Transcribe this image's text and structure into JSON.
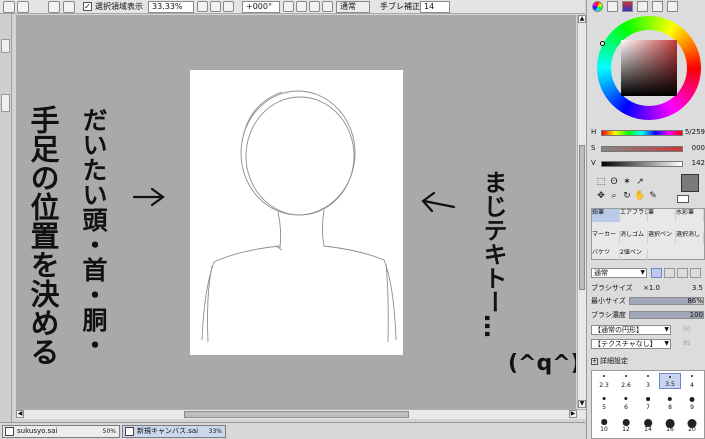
{
  "toolbar": {
    "selection_toggle_label": "選択領域表示",
    "zoom_value": "33.33%",
    "rotation_value": "+000°",
    "blend_mode": "通常",
    "stabilizer_label": "手ブレ補正",
    "stabilizer_value": "14"
  },
  "canvas_annotations": {
    "left_vertical_1": "手足の位置を決める",
    "left_vertical_2": "だいたい頭・首・胴・",
    "right_vertical": "まじテキトー…",
    "right_face": "(^q^)"
  },
  "document_tabs": [
    {
      "name": "sukusyo.sai",
      "zoom": "50%",
      "active": false
    },
    {
      "name": "新規キャンバス.sai",
      "zoom": "33%",
      "active": true
    }
  ],
  "color_panel": {
    "h_label": "H",
    "h_value": "5/259",
    "s_label": "S",
    "s_value": "000",
    "v_label": "V",
    "v_value": "142",
    "sv_color": "#c23b3b",
    "main_swatch_color": "#7a7a7a",
    "sv_marker": {
      "saturation": 0.0,
      "value": 0.56
    }
  },
  "tool_icons": [
    "selection-icon",
    "lasso-icon",
    "magic-wand-icon",
    "eyedropper-icon",
    "move-icon",
    "zoom-icon",
    "rotate-icon",
    "hand-icon",
    "pen-icon"
  ],
  "brush_tools": [
    {
      "label": "鉛筆",
      "selected": true
    },
    {
      "label": "エアブラシ",
      "selected": false
    },
    {
      "label": "筆",
      "selected": false
    },
    {
      "label": "水彩筆",
      "selected": false
    },
    {
      "label": "マーカー",
      "selected": false
    },
    {
      "label": "消しゴム",
      "selected": false
    },
    {
      "label": "選択ペン",
      "selected": false
    },
    {
      "label": "選択消し",
      "selected": false
    },
    {
      "label": "バケツ",
      "selected": false
    },
    {
      "label": "2値ペン",
      "selected": false
    }
  ],
  "brush_props": {
    "mode": "通常",
    "size_label": "ブラシサイズ",
    "size_multiplier": "×1.0",
    "size_value": "3.5",
    "min_size_label": "最小サイズ",
    "min_size_value": "86%",
    "min_size_fraction": 0.86,
    "density_label": "ブラシ濃度",
    "density_value": "100",
    "density_fraction": 1.0,
    "shape_dropdown": "【通常の円形】",
    "shape_strength": "50",
    "texture_dropdown": "【テクスチャなし】",
    "texture_strength": "95",
    "detail_label": "詳細設定"
  },
  "brush_sizes": [
    "2.3",
    "2.6",
    "3",
    "3.5",
    "4",
    "5",
    "6",
    "7",
    "8",
    "9",
    "10",
    "12",
    "14",
    "16",
    "20"
  ],
  "selected_brush_size": "3.5"
}
